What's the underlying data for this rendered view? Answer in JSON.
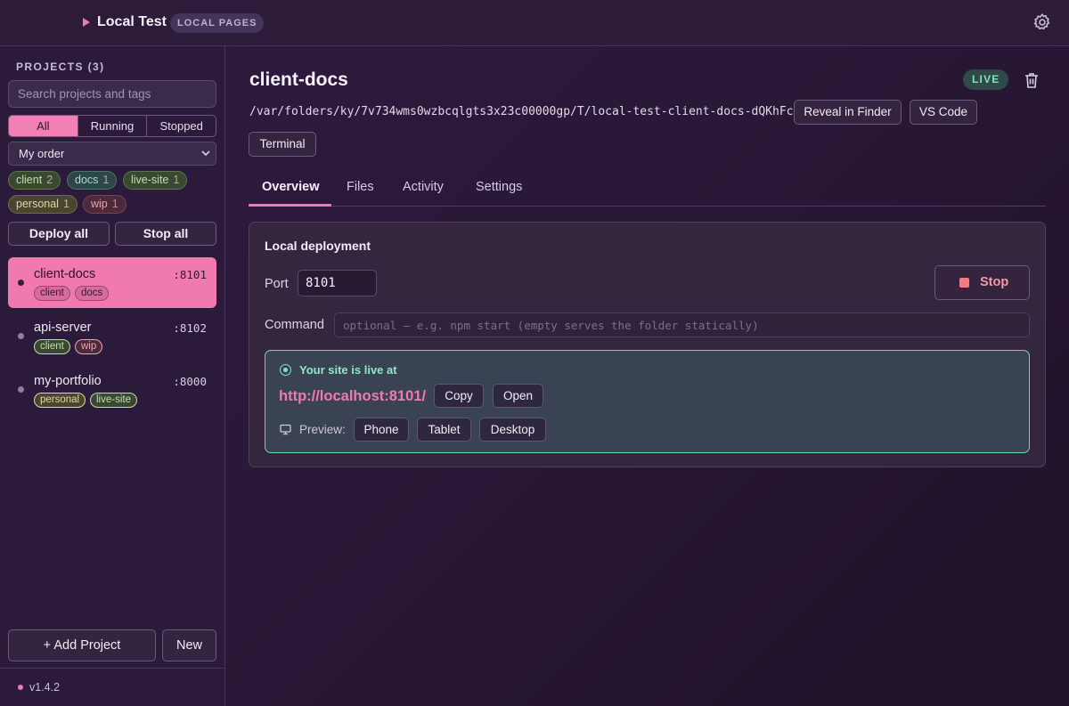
{
  "app": {
    "title": "Local Test",
    "badge": "LOCAL PAGES",
    "version": "v1.4.2"
  },
  "sidebar": {
    "heading": "PROJECTS (3)",
    "search_placeholder": "Search projects and tags",
    "filters": [
      "All",
      "Running",
      "Stopped"
    ],
    "active_filter": "All",
    "sort": "My order",
    "tags": [
      {
        "name": "client",
        "count": "2"
      },
      {
        "name": "docs",
        "count": "1"
      },
      {
        "name": "live-site",
        "count": "1"
      },
      {
        "name": "personal",
        "count": "1"
      },
      {
        "name": "wip",
        "count": "1"
      }
    ],
    "deploy_all": "Deploy all",
    "stop_all": "Stop all",
    "projects": [
      {
        "name": "client-docs",
        "port": ":8101",
        "tags": [
          "client",
          "docs"
        ],
        "active": true
      },
      {
        "name": "api-server",
        "port": ":8102",
        "tags": [
          "client",
          "wip"
        ],
        "active": false
      },
      {
        "name": "my-portfolio",
        "port": ":8000",
        "tags": [
          "personal",
          "live-site"
        ],
        "active": false
      }
    ],
    "add_project": "+ Add Project",
    "new": "New"
  },
  "main": {
    "title": "client-docs",
    "status": "LIVE",
    "path": "/var/folders/ky/7v734wms0wzbcqlgts3x23c00000gp/T/local-test-client-docs-dQKhFc",
    "actions": [
      "Reveal in Finder",
      "VS Code",
      "Terminal"
    ],
    "tabs": [
      "Overview",
      "Files",
      "Activity",
      "Settings"
    ],
    "active_tab": "Overview",
    "panel": {
      "title": "Local deployment",
      "port_label": "Port",
      "port_value": "8101",
      "command_label": "Command",
      "command_placeholder": "optional — e.g. npm start (empty serves the folder statically)",
      "stop_label": "Stop",
      "live_text": "Your site is live at",
      "url": "http://localhost:8101/",
      "copy": "Copy",
      "open": "Open",
      "preview_label": "Preview:",
      "preview_options": [
        "Phone",
        "Tablet",
        "Desktop"
      ]
    }
  },
  "colors": {
    "accent": "#f07ab0",
    "live": "#7fe3bd",
    "stop": "#f47b80"
  }
}
